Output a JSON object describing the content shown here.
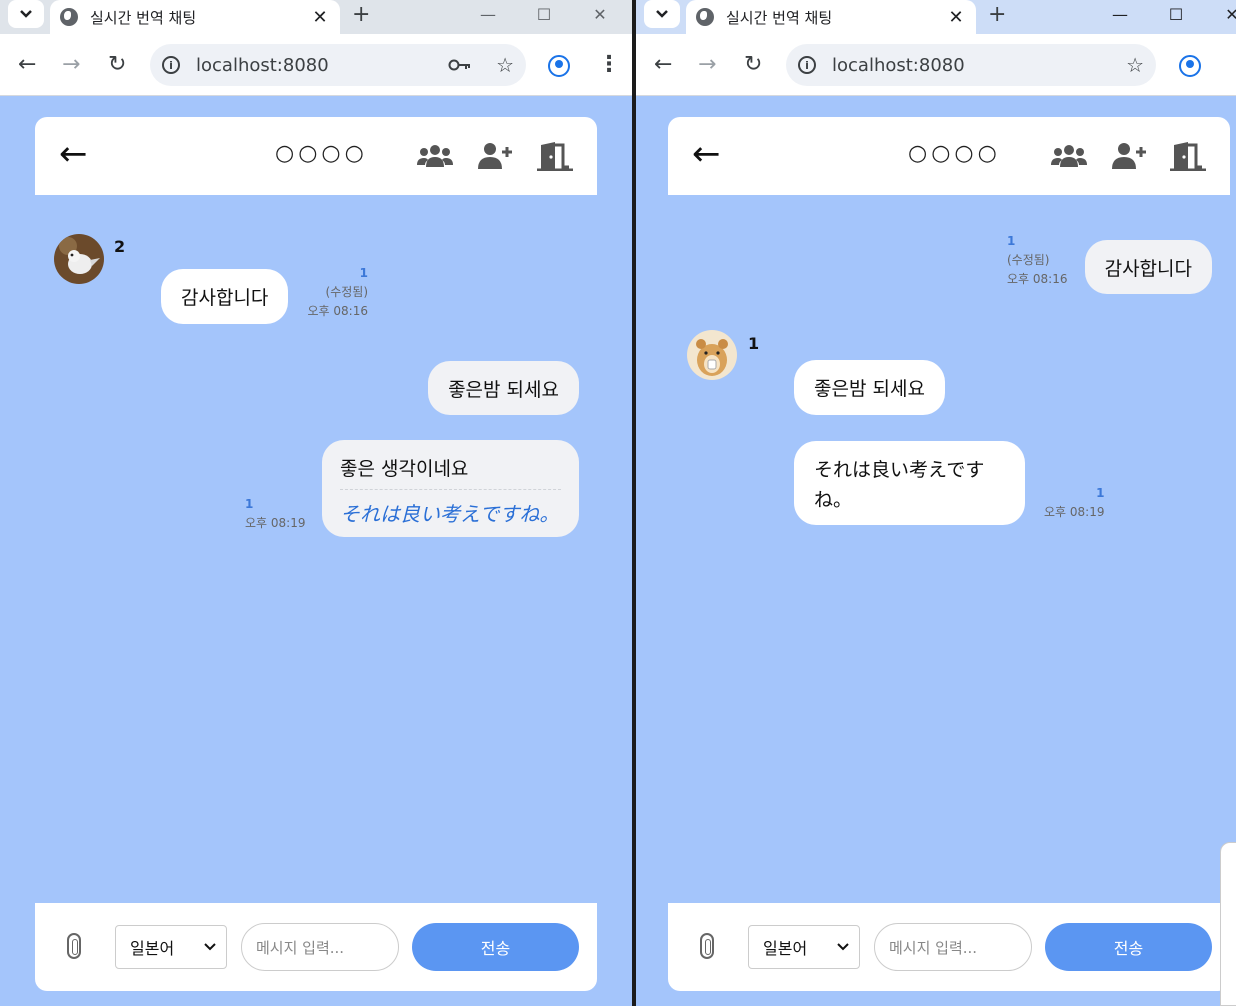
{
  "windows": {
    "left": {
      "tab_title": "실시간 번역 채팅",
      "url": "localhost:8080",
      "room_name": "○○○○",
      "messages": {
        "m1": {
          "sender": "2",
          "text": "감사합니다",
          "read_count": "1",
          "edited": "(수정됨)",
          "time": "오후 08:16"
        },
        "m2": {
          "text": "좋은밤 되세요"
        },
        "m3": {
          "text": "좋은 생각이네요",
          "translation": "それは良い考えですね。",
          "read_count": "1",
          "time": "오후 08:19"
        }
      },
      "footer": {
        "language": "일본어",
        "placeholder": "메시지 입력...",
        "send_label": "전송"
      }
    },
    "right": {
      "tab_title": "실시간 번역 채팅",
      "url": "localhost:8080",
      "room_name": "○○○○",
      "messages": {
        "m1": {
          "text": "감사합니다",
          "read_count": "1",
          "edited": "(수정됨)",
          "time": "오후 08:16"
        },
        "m2": {
          "sender": "1",
          "text": "좋은밤 되세요"
        },
        "m3": {
          "text": "それは良い考えですね。",
          "read_count": "1",
          "time": "오후 08:19"
        }
      },
      "footer": {
        "language": "일본어",
        "placeholder": "메시지 입력...",
        "send_label": "전송"
      }
    }
  },
  "icons": {
    "tab_menu": "chevron-down-icon",
    "site": "globe-icon",
    "back": "arrow-left-icon",
    "members": "users-icon",
    "invite": "user-plus-icon",
    "leave": "door-open-icon",
    "attach": "paperclip-icon"
  },
  "colors": {
    "chat_background": "#a4c5fb",
    "send_button": "#5b96f2",
    "read_count": "#3c78d8",
    "translation_text": "#2a6fd6"
  }
}
